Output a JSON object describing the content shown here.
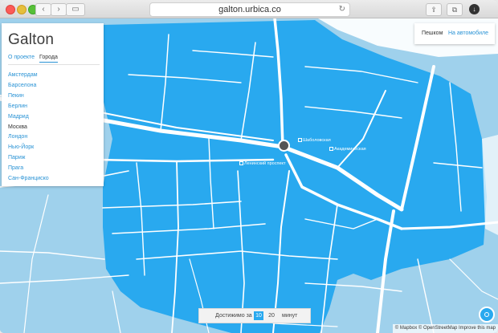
{
  "browser": {
    "url": "galton.urbica.co",
    "icons": [
      "back-icon",
      "forward-icon",
      "sidebar-icon",
      "reload-icon",
      "share-icon",
      "tabs-icon",
      "download-icon"
    ]
  },
  "sidebar": {
    "brand": "Galton",
    "tabs": [
      {
        "label": "О проекте",
        "active": false
      },
      {
        "label": "Города",
        "active": true
      }
    ],
    "cities": [
      "Амстердам",
      "Барселона",
      "Пекин",
      "Берлин",
      "Мадрид",
      "Москва",
      "Лондон",
      "Нью-Йорк",
      "Париж",
      "Прага",
      "Сан-Франциско"
    ],
    "current_city": "Москва"
  },
  "mode": {
    "walk_label": "Пешком",
    "car_label": "На автомобиле",
    "active": "walk"
  },
  "timebar": {
    "label": "Достижимо за",
    "options": [
      "10",
      "20"
    ],
    "selected": "10",
    "unit": "минут"
  },
  "pois": [
    "Шаболовская",
    "Академическая",
    "Ленинский проспект"
  ],
  "attribution": "© Mapbox © OpenStreetMap Improve this map",
  "colors": {
    "isochrone": "#29a9ef",
    "outer_map": "#9fd1ec",
    "link": "#2a93d5",
    "marker": "#555555"
  }
}
